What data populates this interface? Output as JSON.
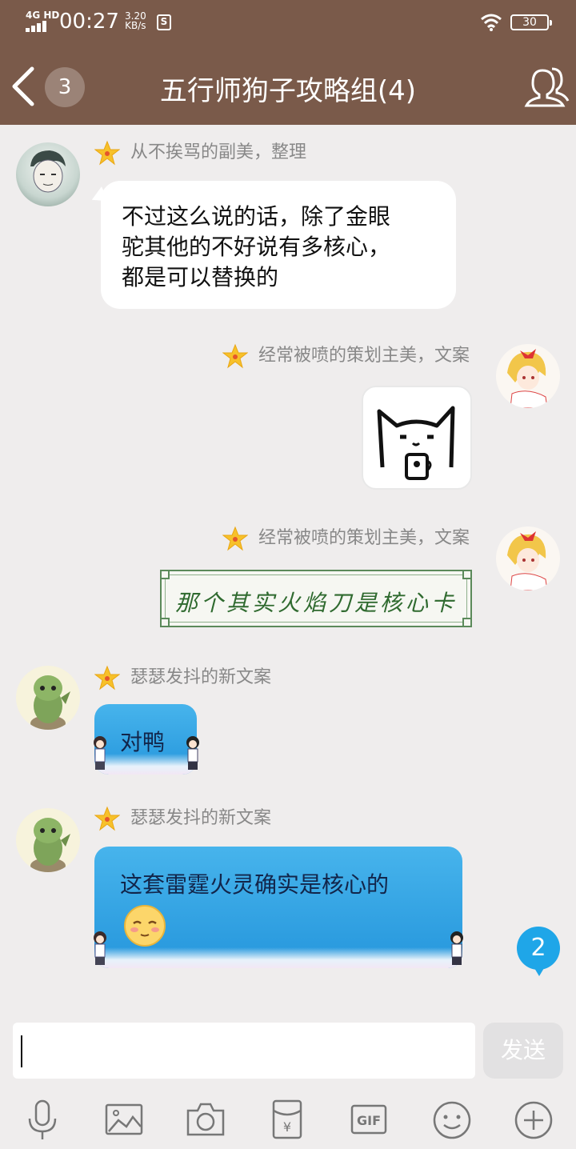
{
  "status_bar": {
    "network": "4G HD",
    "time": "00:27",
    "speed_value": "3.20",
    "speed_unit": "KB/s",
    "sim_icon_text": "S",
    "battery": "30"
  },
  "header": {
    "unread_count": "3",
    "title": "五行师狗子攻略组(4)"
  },
  "messages": [
    {
      "sender": "从不挨骂的副美，整理",
      "text_lines": [
        "不过这么说的话，除了金眼",
        "驼其他的不好说有多核心，",
        "都是可以替换的"
      ]
    },
    {
      "sender": "经常被喷的策划主美，文案",
      "sticker": "cat-holding-cup-sticker"
    },
    {
      "sender": "经常被喷的策划主美，文案",
      "card_text": "那个其实火焰刀是核心卡"
    },
    {
      "sender": "瑟瑟发抖的新文案",
      "text": "对鸭"
    },
    {
      "sender": "瑟瑟发抖的新文案",
      "text": "这套雷霆火灵确实是核心的",
      "emoji": "shy-face"
    }
  ],
  "new_message_badge": "2",
  "input": {
    "placeholder": "",
    "send_label": "发送"
  },
  "toolbar": {
    "gif_label": "GIF",
    "redpacket_label": "¥"
  },
  "colors": {
    "header_bg": "#7a5a4a",
    "blue_bubble": "#2596dc",
    "badge_blue": "#1fa6e8",
    "chat_bg": "#efeded"
  }
}
